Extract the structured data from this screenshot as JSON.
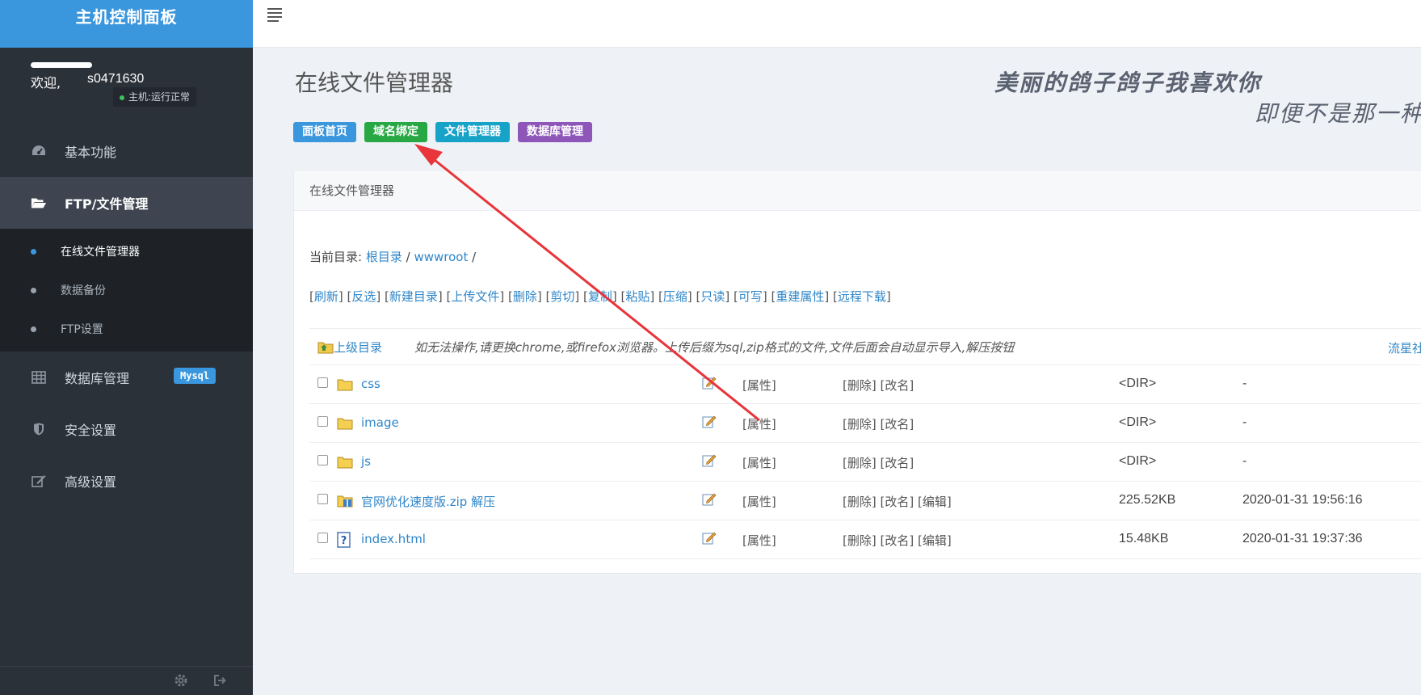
{
  "sidebar": {
    "brand": "主机控制面板",
    "welcome": "欢迎,",
    "username": "s0471630",
    "host_status": "主机:运行正常",
    "menu": [
      {
        "label": "基本功能"
      },
      {
        "label": "FTP/文件管理"
      },
      {
        "label": "数据库管理",
        "badge": "Mysql"
      },
      {
        "label": "安全设置"
      },
      {
        "label": "高级设置"
      }
    ],
    "submenu": [
      {
        "label": "在线文件管理器"
      },
      {
        "label": "数据备份"
      },
      {
        "label": "FTP设置"
      }
    ]
  },
  "main": {
    "title": "在线文件管理器",
    "slogan_line1": "美丽的鸽子鸽子我喜欢你",
    "slogan_line2": "即便不是那一种",
    "quick_buttons": [
      "面板首页",
      "域名绑定",
      "文件管理器",
      "数据库管理"
    ],
    "panel_title": "在线文件管理器",
    "current_dir_label": "当前目录:",
    "breadcrumb": [
      "根目录",
      "wwwroot"
    ],
    "breadcrumb_sep": "/",
    "actions": [
      "刷新",
      "反选",
      "新建目录",
      "上传文件",
      "删除",
      "剪切",
      "复制",
      "粘贴",
      "压缩",
      "只读",
      "可写",
      "重建属性",
      "远程下载"
    ],
    "parent_dir": "上级目录",
    "note": "如无法操作,请更换chrome,或firefox浏览器。上传后缀为sql,zip格式的文件,文件后面会自动显示导入,解压按钮",
    "community": "流星社区",
    "labels": {
      "prop": "[属性]",
      "delete": "[删除]",
      "rename": "[改名]",
      "edit": "[编辑]"
    },
    "files": [
      {
        "name": "css",
        "type": "dir",
        "size": "<DIR>",
        "mtime": "-"
      },
      {
        "name": "image",
        "type": "dir",
        "size": "<DIR>",
        "mtime": "-"
      },
      {
        "name": "js",
        "type": "dir",
        "size": "<DIR>",
        "mtime": "-"
      },
      {
        "name": "官网优化速度版.zip",
        "extra": "解压",
        "type": "zip",
        "size": "225.52KB",
        "mtime": "2020-01-31 19:56:16"
      },
      {
        "name": "index.html",
        "type": "html",
        "size": "15.48KB",
        "mtime": "2020-01-31 19:37:36"
      }
    ]
  },
  "colors": {
    "sidebar_bg": "#2b3139",
    "brand_bg": "#3a96dd",
    "arrow": "#e8343a"
  }
}
